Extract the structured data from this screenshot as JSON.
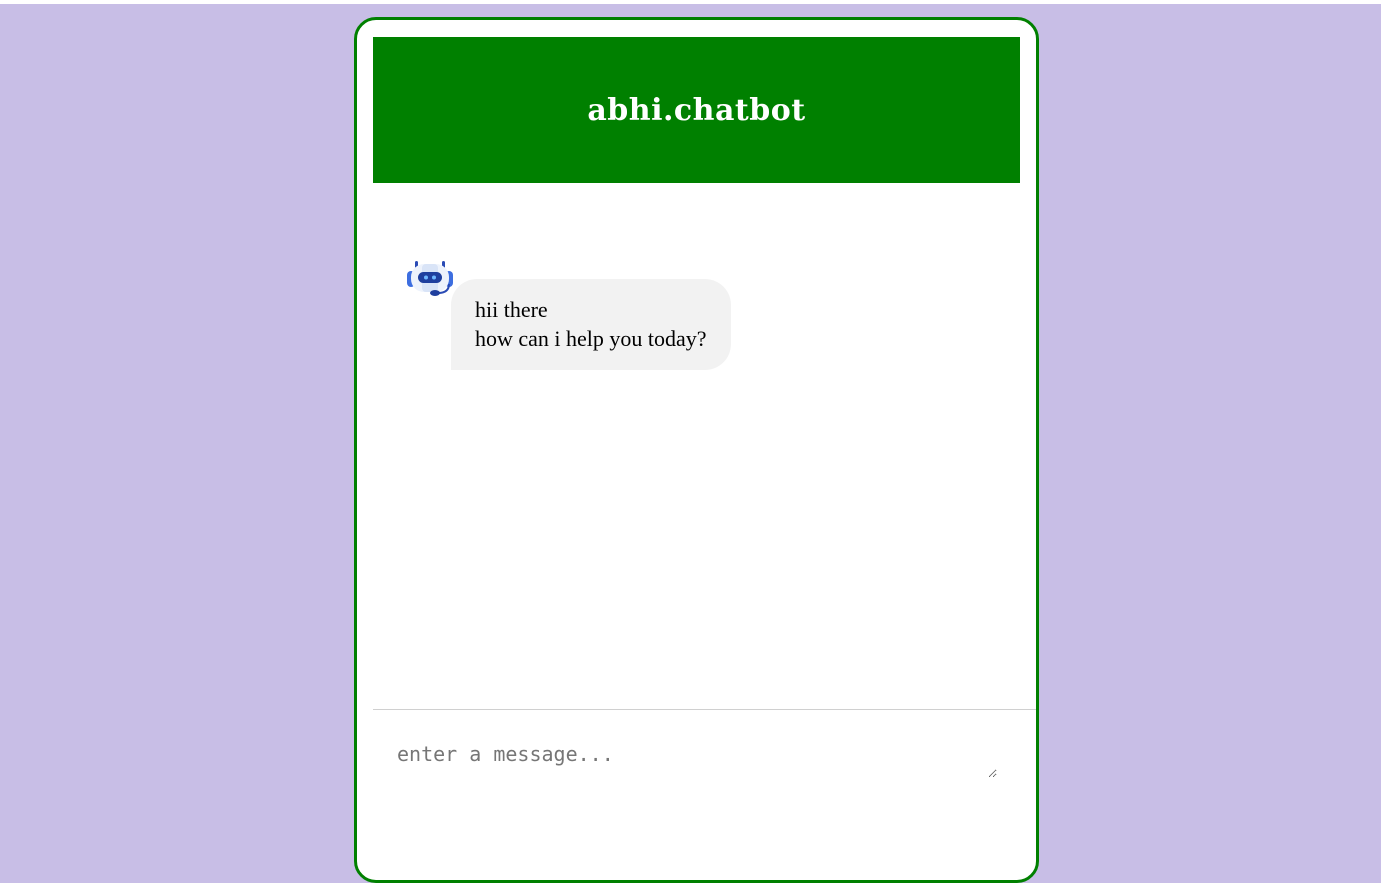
{
  "header": {
    "title": "abhi.chatbot"
  },
  "messages": [
    {
      "sender": "bot",
      "avatar_icon": "robot-icon",
      "text": "hii there\nhow can i help you today?"
    }
  ],
  "composer": {
    "placeholder": "enter a message...",
    "value": ""
  },
  "colors": {
    "page_background": "#c8bee6",
    "header_background": "#008000",
    "window_border": "#008000",
    "bubble_background": "#f2f2f2",
    "header_text": "#ffffff"
  }
}
